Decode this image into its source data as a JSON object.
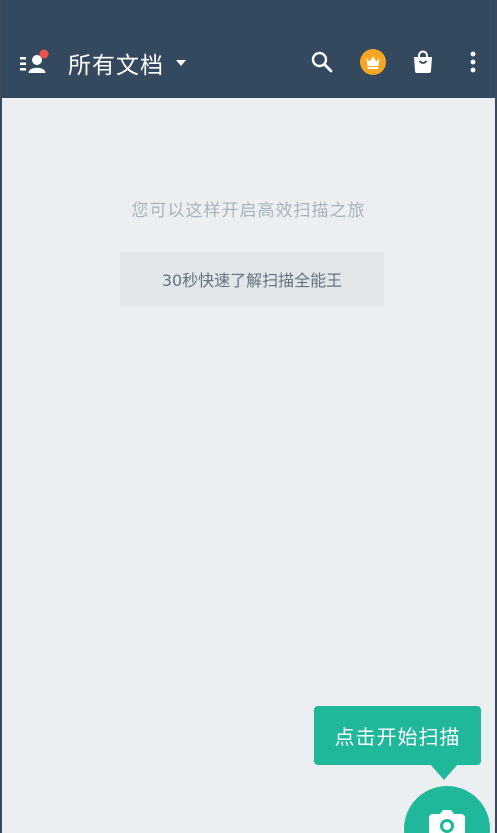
{
  "header": {
    "title": "所有文档",
    "icons": [
      "menu-icon",
      "search-icon",
      "crown-icon",
      "shopping-bag-icon",
      "more-vertical-icon"
    ],
    "notification_dot_color": "#ef5350",
    "background": "#34495e"
  },
  "empty_state": {
    "hint": "您可以这样开启高效扫描之旅",
    "guide_button_label": "30秒快速了解扫描全能王"
  },
  "scan": {
    "tooltip": "点击开始扫描",
    "fab_icon": "camera-icon",
    "accent": "#1fb89a"
  }
}
